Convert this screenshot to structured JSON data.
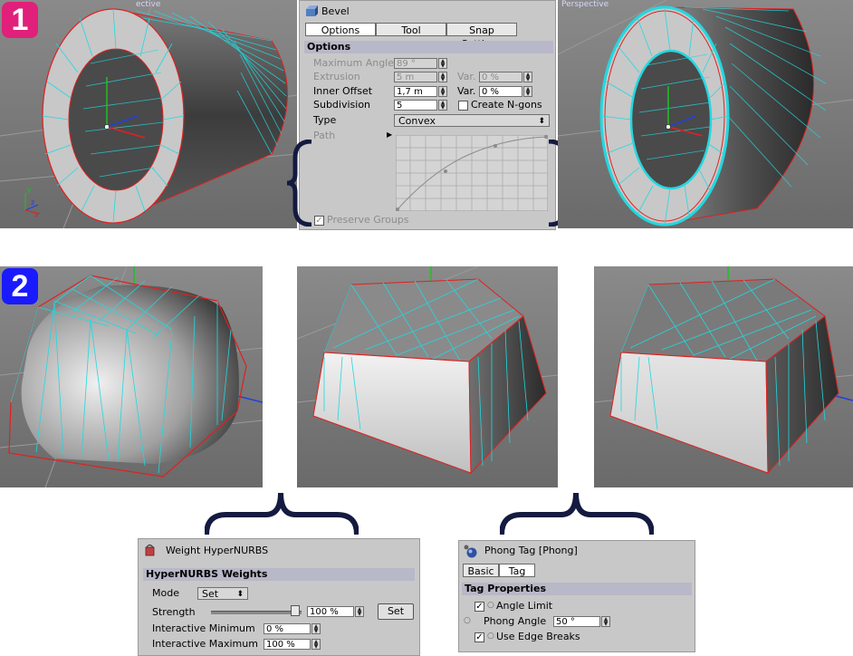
{
  "badges": {
    "one": "1",
    "two": "2"
  },
  "colors": {
    "badge_one": "#e0207a",
    "badge_two": "#1a1aff",
    "edge_selection": "#22d8e0",
    "edge_outline": "#e02020",
    "brace": "#141a40"
  },
  "viewports": {
    "top_left_title": "ective",
    "top_right_title": "Perspective"
  },
  "bevel": {
    "title": "Bevel",
    "icon": "bevel-icon",
    "tabs": [
      "Options",
      "Tool",
      "Snap Settings"
    ],
    "section": "Options",
    "rows": {
      "max_angle_label": "Maximum Angle",
      "max_angle_value": "89 °",
      "extrusion_label": "Extrusion",
      "extrusion_value": "5 m",
      "extrusion_var_label": "Var.",
      "extrusion_var_value": "0 %",
      "inner_offset_label": "Inner Offset",
      "inner_offset_value": "1,7 m",
      "inner_offset_var_label": "Var.",
      "inner_offset_var_value": "0 %",
      "subdivision_label": "Subdivision",
      "subdivision_value": "5",
      "create_ngons_label": "Create N-gons",
      "create_ngons_checked": false,
      "type_label": "Type",
      "type_value": "Convex",
      "path_label": "Path",
      "preserve_groups_label": "Preserve Groups",
      "preserve_groups_checked": true
    }
  },
  "hypernurbs": {
    "title": "Weight HyperNURBS",
    "icon": "weight-hypernurbs-icon",
    "section": "HyperNURBS Weights",
    "mode_label": "Mode",
    "mode_value": "Set",
    "strength_label": "Strength",
    "strength_value": "100 %",
    "strength_slider": 1.0,
    "set_button": "Set",
    "int_min_label": "Interactive Minimum",
    "int_min_value": "0 %",
    "int_max_label": "Interactive Maximum",
    "int_max_value": "100 %"
  },
  "phong": {
    "title": "Phong Tag [Phong]",
    "icon": "phong-tag-icon",
    "tabs": [
      "Basic",
      "Tag"
    ],
    "section": "Tag Properties",
    "angle_limit_label": "Angle Limit",
    "angle_limit_checked": true,
    "phong_angle_label": "Phong Angle",
    "phong_angle_value": "50 °",
    "edge_breaks_label": "Use Edge Breaks",
    "edge_breaks_checked": true
  }
}
